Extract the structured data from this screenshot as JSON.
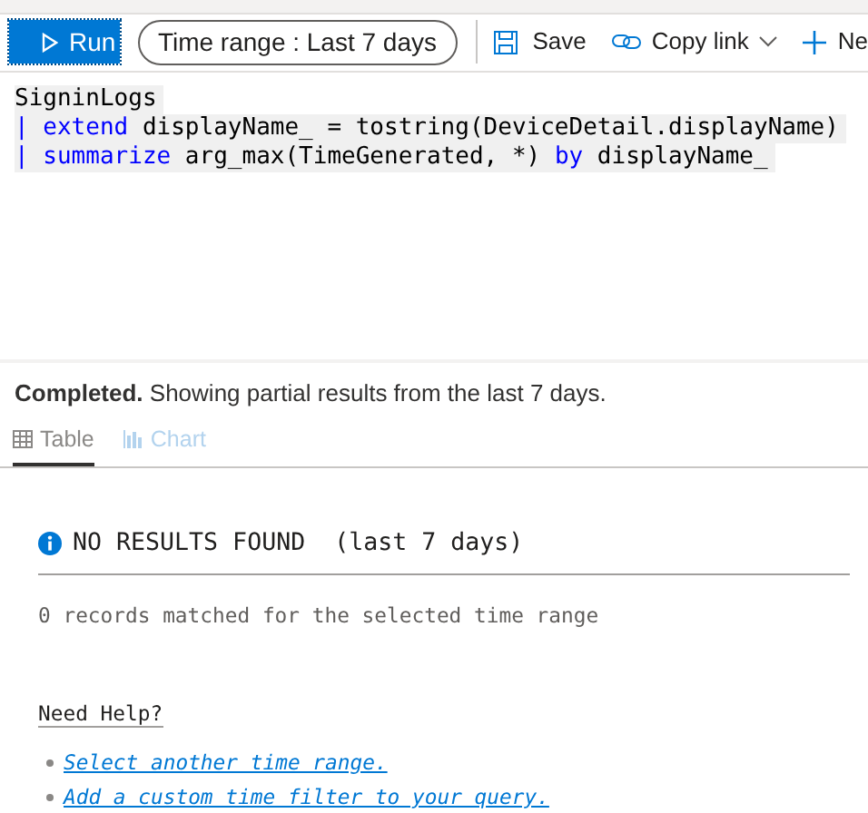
{
  "toolbar": {
    "run_label": "Run",
    "time_range": "Time range : Last 7 days",
    "save_label": "Save",
    "copy_link_label": "Copy link",
    "new_label": "Ne"
  },
  "query": {
    "lines": [
      [
        {
          "kind": "plain",
          "text": "SigninLogs"
        }
      ],
      [
        {
          "kind": "pipe",
          "text": "|"
        },
        {
          "kind": "keyword",
          "text": " extend"
        },
        {
          "kind": "plain",
          "text": " displayName_ = tostring(DeviceDetail.displayName)"
        }
      ],
      [
        {
          "kind": "pipe",
          "text": "|"
        },
        {
          "kind": "keyword",
          "text": " summarize"
        },
        {
          "kind": "plain",
          "text": " arg_max(TimeGenerated, *) "
        },
        {
          "kind": "keyword",
          "text": "by"
        },
        {
          "kind": "plain",
          "text": " displayName_"
        }
      ]
    ]
  },
  "status": "**Completed.** Showing partial results from the last 7 days.",
  "tabs": [
    {
      "label": "Table",
      "selected": true,
      "disabled": false
    },
    {
      "label": "Chart",
      "selected": false,
      "disabled": true
    }
  ],
  "result": {
    "heading": "NO RESULTS FOUND  (last 7 days)",
    "message": "0 records matched for the selected time range",
    "help_title": "Need Help?",
    "help_links": [
      "Select another time range.",
      "Add a custom time filter to your query."
    ]
  }
}
